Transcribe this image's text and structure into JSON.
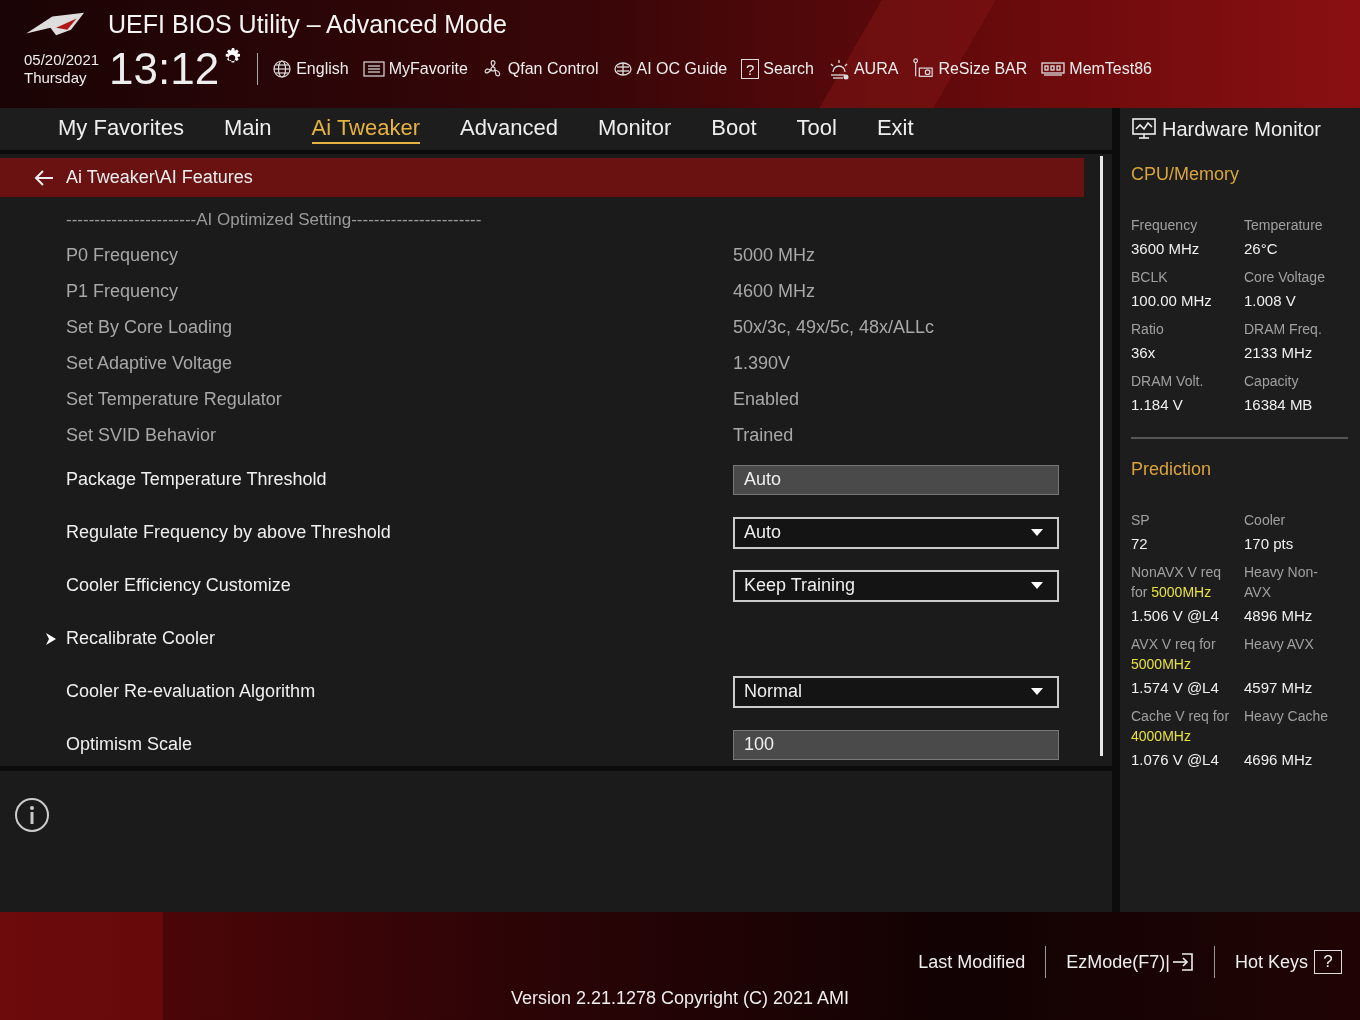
{
  "header": {
    "title": "UEFI BIOS Utility – Advanced Mode",
    "date": "05/20/2021",
    "day": "Thursday",
    "time": "13:12"
  },
  "toolbar": [
    {
      "label": "English",
      "kind": "globe"
    },
    {
      "label": "MyFavorite",
      "kind": "list"
    },
    {
      "label": "Qfan Control",
      "kind": "fan"
    },
    {
      "label": "AI OC Guide",
      "kind": "chip"
    },
    {
      "label": "Search",
      "kind": "help",
      "glyph": "?"
    },
    {
      "label": "AURA",
      "kind": "sun"
    },
    {
      "label": "ReSize BAR",
      "kind": "card"
    },
    {
      "label": "MemTest86",
      "kind": "ram"
    }
  ],
  "tabs": [
    {
      "label": "My Favorites",
      "selected": false
    },
    {
      "label": "Main",
      "selected": false
    },
    {
      "label": "Ai Tweaker",
      "selected": true
    },
    {
      "label": "Advanced",
      "selected": false
    },
    {
      "label": "Monitor",
      "selected": false
    },
    {
      "label": "Boot",
      "selected": false
    },
    {
      "label": "Tool",
      "selected": false
    },
    {
      "label": "Exit",
      "selected": false
    }
  ],
  "breadcrumb": "Ai Tweaker\\AI Features",
  "settings": [
    {
      "kind": "separator",
      "label": "-----------------------AI Optimized Setting-----------------------"
    },
    {
      "kind": "info",
      "label": "P0 Frequency",
      "value": "5000 MHz"
    },
    {
      "kind": "info",
      "label": "P1 Frequency",
      "value": "4600 MHz"
    },
    {
      "kind": "info",
      "label": "Set By Core Loading",
      "value": "50x/3c, 49x/5c, 48x/ALLc"
    },
    {
      "kind": "info",
      "label": "Set Adaptive Voltage",
      "value": "1.390V"
    },
    {
      "kind": "info",
      "label": "Set Temperature Regulator",
      "value": "Enabled"
    },
    {
      "kind": "info",
      "label": "Set SVID Behavior",
      "value": "Trained"
    },
    {
      "kind": "textbox",
      "label": "Package Temperature Threshold",
      "value": "Auto"
    },
    {
      "kind": "dropdown",
      "label": "Regulate Frequency by above Threshold",
      "value": "Auto"
    },
    {
      "kind": "dropdown",
      "label": "Cooler Efficiency Customize",
      "value": "Keep Training"
    },
    {
      "kind": "submenu",
      "label": "Recalibrate Cooler"
    },
    {
      "kind": "dropdown",
      "label": "Cooler Re-evaluation Algorithm",
      "value": "Normal"
    },
    {
      "kind": "textbox",
      "label": "Optimism Scale",
      "value": "100"
    }
  ],
  "hardware_monitor": {
    "title": "Hardware Monitor",
    "sections": [
      {
        "title": "CPU/Memory",
        "items": [
          {
            "label": "Frequency",
            "value": "3600 MHz"
          },
          {
            "label": "Temperature",
            "value": "26°C"
          },
          {
            "label": "BCLK",
            "value": "100.00 MHz"
          },
          {
            "label": "Core Voltage",
            "value": "1.008 V"
          },
          {
            "label": "Ratio",
            "value": "36x"
          },
          {
            "label": "DRAM Freq.",
            "value": "2133 MHz"
          },
          {
            "label": "DRAM Volt.",
            "value": "1.184 V"
          },
          {
            "label": "Capacity",
            "value": "16384 MB"
          }
        ]
      },
      {
        "title": "Prediction",
        "items": [
          {
            "label": "SP",
            "value": "72"
          },
          {
            "label": "Cooler",
            "value": "170 pts"
          },
          {
            "label": "NonAVX V req for **5000MHz**",
            "value": "1.506 V @L4"
          },
          {
            "label": "Heavy Non-AVX",
            "value": "4896 MHz"
          },
          {
            "label": "AVX V req for **5000MHz**",
            "value": "1.574 V @L4"
          },
          {
            "label": "Heavy AVX",
            "value": "4597 MHz"
          },
          {
            "label": "Cache V req for **4000MHz**",
            "value": "1.076 V @L4"
          },
          {
            "label": "Heavy Cache",
            "value": "4696 MHz"
          }
        ]
      }
    ]
  },
  "footer": {
    "last_modified": "Last Modified",
    "ezmode": "EzMode(F7)|",
    "hot_keys": "Hot Keys",
    "hot_keys_key": "?",
    "version": "Version 2.21.1278 Copyright (C) 2021 AMI"
  }
}
